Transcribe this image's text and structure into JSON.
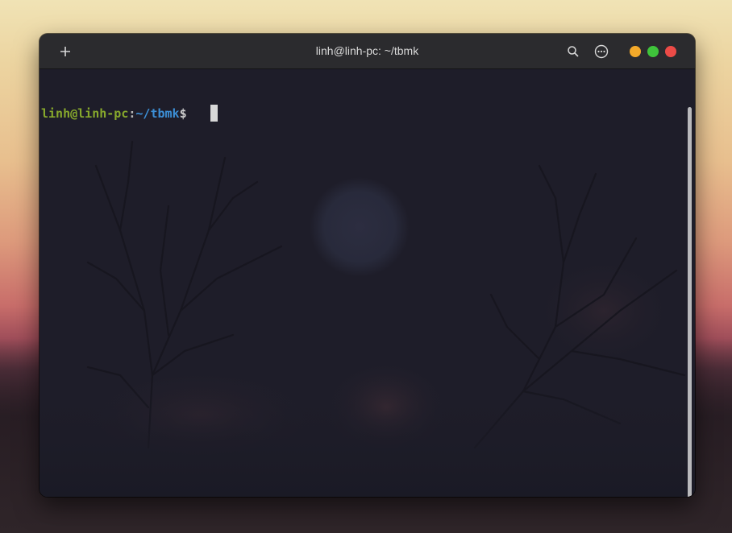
{
  "window": {
    "title": "linh@linh-pc: ~/tbmk"
  },
  "titlebar": {
    "new_tab_icon": "plus-icon",
    "search_icon": "search-icon",
    "menu_icon": "ellipsis-circle-icon",
    "traffic_lights": {
      "minimize_color": "#f3a92a",
      "maximize_color": "#3fc43b",
      "close_color": "#ec4b47"
    }
  },
  "terminal": {
    "prompt": {
      "user_host": "linh@linh-pc",
      "separator": ":",
      "path": "~/tbmk",
      "symbol": "$"
    },
    "colors": {
      "user_host": "#87a82c",
      "path": "#3c8fd6",
      "background": "#1e1d29"
    }
  }
}
